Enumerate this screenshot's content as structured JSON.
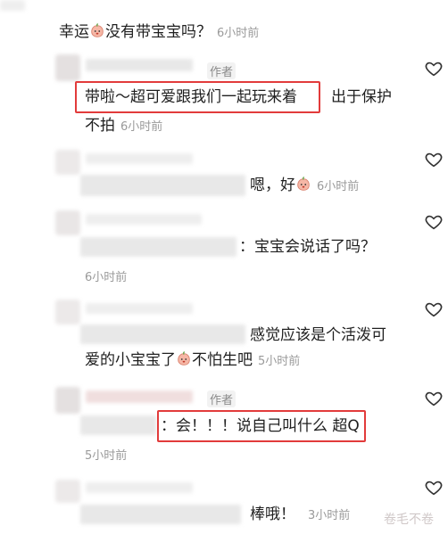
{
  "comments": [
    {
      "text": "幸运",
      "text2": "没有带宝宝吗？",
      "time": "6小时前"
    },
    {
      "author_tag": "作者",
      "highlight": "带啦～超可爱跟我们一起玩来着",
      "tail": "出于保护",
      "line2": "不拍",
      "time": "6小时前"
    },
    {
      "text": "嗯，好",
      "time": "6小时前"
    },
    {
      "text": "：宝宝会说话了吗？",
      "time": "6小时前"
    },
    {
      "line1": "感觉应该是个活泼可",
      "line2a": "爱的小宝宝了",
      "line2b": "不怕生吧",
      "time": "5小时前"
    },
    {
      "author_tag": "作者",
      "highlight": "：会！！！说自己叫什么 超Q",
      "time": "5小时前"
    },
    {
      "text": "棒哦！",
      "time": "3小时前"
    }
  ],
  "watermark": "卷毛不卷",
  "icons": {
    "like": "heart-outline-icon",
    "emoji": "peach-face-emoji"
  }
}
